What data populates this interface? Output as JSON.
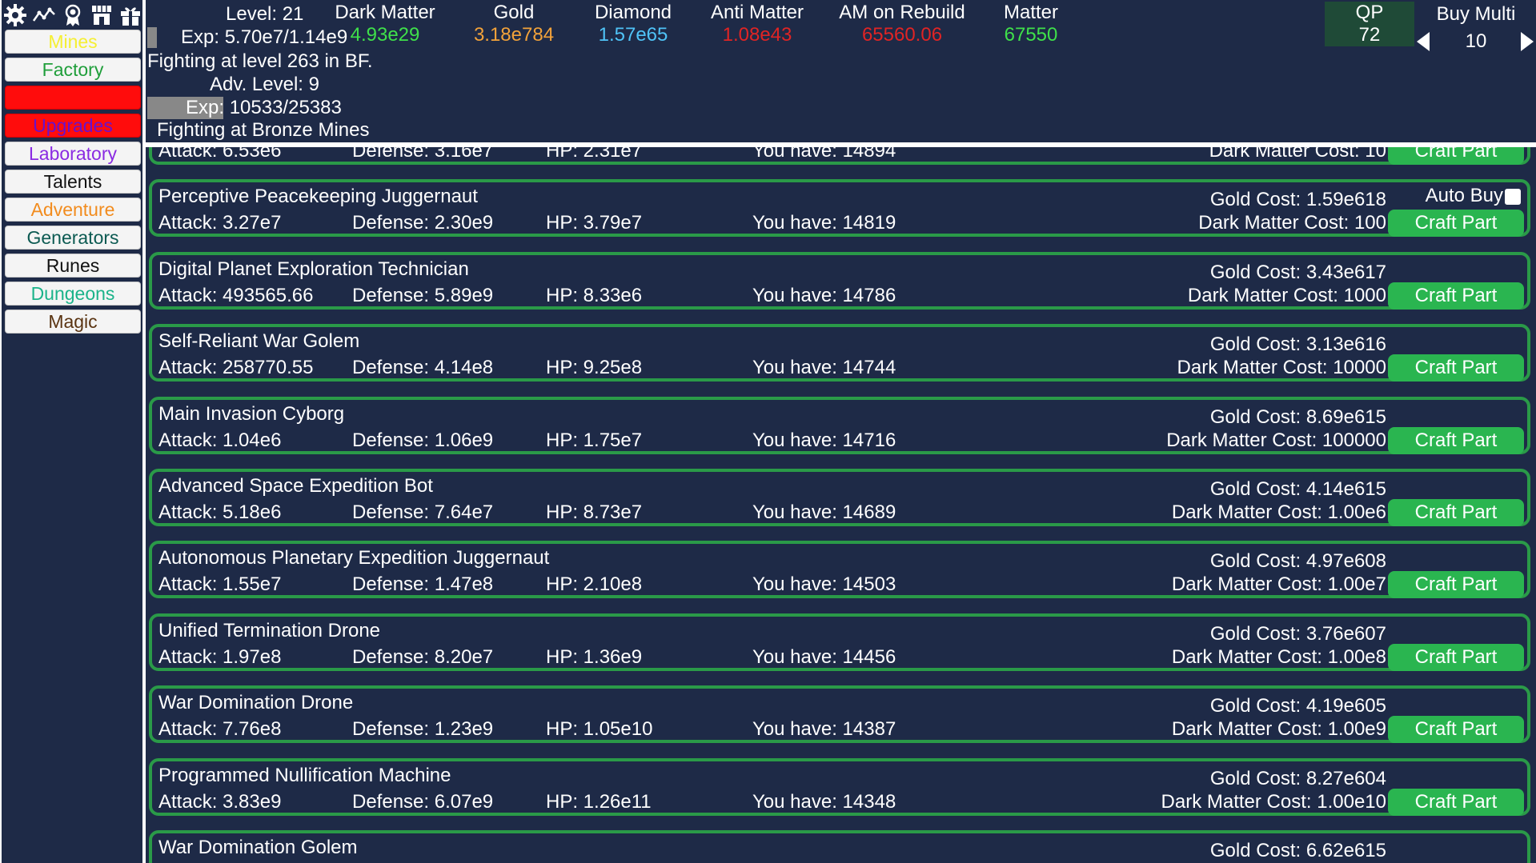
{
  "colors": {
    "panel_bg": "#1e2a47",
    "row_border": "#2a9a48",
    "craft_btn": "#2ab550",
    "qp_bg": "#1f4a37"
  },
  "toolbar_icons": [
    "gear-icon",
    "stats-chart-icon",
    "award-icon",
    "shop-icon",
    "gift-icon"
  ],
  "nav": [
    {
      "label": "Mines",
      "color": "#f5ef32",
      "bg": "normal"
    },
    {
      "label": "Factory",
      "color": "#1f9e3a",
      "bg": "normal"
    },
    {
      "label": "",
      "color": "#ffffff",
      "bg": "red"
    },
    {
      "label": "Upgrades",
      "color": "#6a11cb",
      "bg": "red"
    },
    {
      "label": "Laboratory",
      "color": "#8a2be2",
      "bg": "normal"
    },
    {
      "label": "Talents",
      "color": "#111111",
      "bg": "normal"
    },
    {
      "label": "Adventure",
      "color": "#f28c1e",
      "bg": "normal"
    },
    {
      "label": "Generators",
      "color": "#0c5a52",
      "bg": "normal"
    },
    {
      "label": "Runes",
      "color": "#111111",
      "bg": "normal"
    },
    {
      "label": "Dungeons",
      "color": "#1bb38a",
      "bg": "normal"
    },
    {
      "label": "Magic",
      "color": "#5a3412",
      "bg": "normal"
    }
  ],
  "player": {
    "level": "Level: 21",
    "exp": "Exp: 5.70e7/1.14e9",
    "exp_progress": 0.05,
    "fighting": "Fighting at level 263 in BF.",
    "adv_level": "Adv. Level: 9",
    "adv_exp": "Exp: 10533/25383",
    "adv_exp_progress": 0.41,
    "adv_fighting": "Fighting at Bronze Mines"
  },
  "resources": [
    {
      "label": "Dark Matter",
      "value": "4.93e29",
      "color": "#3fe04a"
    },
    {
      "label": "Gold",
      "value": "3.18e784",
      "color": "#f2a23a"
    },
    {
      "label": "Diamond",
      "value": "1.57e65",
      "color": "#4fc3f7"
    },
    {
      "label": "Anti Matter",
      "value": "1.08e43",
      "color": "#e02424"
    },
    {
      "label": "AM on Rebuild",
      "value": "65560.06",
      "color": "#e02424"
    },
    {
      "label": "Matter",
      "value": "67550",
      "color": "#3fe04a"
    }
  ],
  "qp": {
    "label": "QP",
    "value": "72"
  },
  "buy_multi": {
    "label": "Buy Multi",
    "value": "10"
  },
  "craft_label": "Craft Part",
  "auto_buy_label": "Auto Buy",
  "parts": [
    {
      "name": "",
      "attack": "Attack: 6.53e6",
      "defense": "Defense: 3.16e7",
      "hp": "HP: 2.31e7",
      "have": "You have: 14894",
      "gold": "",
      "dm": "Dark Matter Cost: 10"
    },
    {
      "name": "Perceptive Peacekeeping Juggernaut",
      "attack": "Attack: 3.27e7",
      "defense": "Defense: 2.30e9",
      "hp": "HP: 3.79e7",
      "have": "You have: 14819",
      "gold": "Gold Cost: 1.59e618",
      "dm": "Dark Matter Cost: 100",
      "auto_buy": true
    },
    {
      "name": "Digital Planet Exploration Technician",
      "attack": "Attack: 493565.66",
      "defense": "Defense: 5.89e9",
      "hp": "HP: 8.33e6",
      "have": "You have: 14786",
      "gold": "Gold Cost: 3.43e617",
      "dm": "Dark Matter Cost: 1000"
    },
    {
      "name": "Self-Reliant War Golem",
      "attack": "Attack: 258770.55",
      "defense": "Defense: 4.14e8",
      "hp": "HP: 9.25e8",
      "have": "You have: 14744",
      "gold": "Gold Cost: 3.13e616",
      "dm": "Dark Matter Cost: 10000"
    },
    {
      "name": "Main Invasion Cyborg",
      "attack": "Attack: 1.04e6",
      "defense": "Defense: 1.06e9",
      "hp": "HP: 1.75e7",
      "have": "You have: 14716",
      "gold": "Gold Cost: 8.69e615",
      "dm": "Dark Matter Cost: 100000"
    },
    {
      "name": "Advanced Space Expedition Bot",
      "attack": "Attack: 5.18e6",
      "defense": "Defense: 7.64e7",
      "hp": "HP: 8.73e7",
      "have": "You have: 14689",
      "gold": "Gold Cost: 4.14e615",
      "dm": "Dark Matter Cost: 1.00e6"
    },
    {
      "name": "Autonomous Planetary Expedition Juggernaut",
      "attack": "Attack: 1.55e7",
      "defense": "Defense: 1.47e8",
      "hp": "HP: 2.10e8",
      "have": "You have: 14503",
      "gold": "Gold Cost: 4.97e608",
      "dm": "Dark Matter Cost: 1.00e7"
    },
    {
      "name": "Unified Termination Drone",
      "attack": "Attack: 1.97e8",
      "defense": "Defense: 8.20e7",
      "hp": "HP: 1.36e9",
      "have": "You have: 14456",
      "gold": "Gold Cost: 3.76e607",
      "dm": "Dark Matter Cost: 1.00e8"
    },
    {
      "name": "War Domination Drone",
      "attack": "Attack: 7.76e8",
      "defense": "Defense: 1.23e9",
      "hp": "HP: 1.05e10",
      "have": "You have: 14387",
      "gold": "Gold Cost: 4.19e605",
      "dm": "Dark Matter Cost: 1.00e9"
    },
    {
      "name": "Programmed Nullification Machine",
      "attack": "Attack: 3.83e9",
      "defense": "Defense: 6.07e9",
      "hp": "HP: 1.26e11",
      "have": "You have: 14348",
      "gold": "Gold Cost: 8.27e604",
      "dm": "Dark Matter Cost: 1.00e10"
    },
    {
      "name": "War Domination Golem",
      "attack": "",
      "defense": "",
      "hp": "",
      "have": "",
      "gold": "Gold Cost: 6.62e615",
      "dm": ""
    }
  ]
}
